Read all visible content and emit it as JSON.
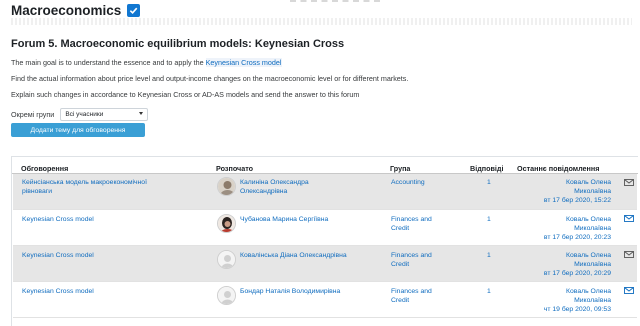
{
  "course": {
    "title": "Macroeconomics"
  },
  "forum": {
    "title": "Forum 5. Macroeconomic equilibrium models: Keynesian Cross",
    "intro_line1_prefix": "The main goal is to understand the essence and to apply the",
    "intro_line1_link": "Keynesian Cross model",
    "intro_line2": "Find the actual information about price level and output-income changes on the macroeconomic level or for different markets.",
    "intro_line3": "Explain such changes in accordance to Keynesian Cross or AD-AS models and send the answer to this forum"
  },
  "groups": {
    "label": "Окремі групи",
    "selected": "Всі учасники"
  },
  "add_button": "Додати тему для обговорення",
  "table": {
    "headers": {
      "discussion": "Обговорення",
      "started": "Розпочато",
      "group": "Група",
      "replies": "Відповіді",
      "last_post": "Останнє повідомлення"
    },
    "rows": [
      {
        "title_1": "Кейнсіанська модель макроекономічної",
        "title_2": "рівноваги",
        "author_1": "Калиніна Олександра",
        "author_2": "Олександрівна",
        "group_1": "Accounting",
        "group_2": "",
        "replies": "1",
        "last_1": "Коваль Олена",
        "last_2": "Миколаївна",
        "last_3": "вт 17 бер 2020, 15:22",
        "mail_color": "#555555"
      },
      {
        "title_1": "Keynesian Cross model",
        "title_2": "",
        "author_1": "Чубанова Марина Сергіївна",
        "author_2": "",
        "group_1": "Finances and",
        "group_2": "Credit",
        "replies": "1",
        "last_1": "Коваль Олена",
        "last_2": "Миколаївна",
        "last_3": "вт 17 бер 2020, 20:23",
        "mail_color": "#0f6cbf"
      },
      {
        "title_1": "Keynesian Cross model",
        "title_2": "",
        "author_1": "Ковалінська Діана Олександрівна",
        "author_2": "",
        "group_1": "Finances and",
        "group_2": "Credit",
        "replies": "1",
        "last_1": "Коваль Олена",
        "last_2": "Миколаївна",
        "last_3": "вт 17 бер 2020, 20:29",
        "mail_color": "#555555"
      },
      {
        "title_1": "Keynesian Cross model",
        "title_2": "",
        "author_1": "Бондар Наталія Володимирівна",
        "author_2": "",
        "group_1": "Finances and",
        "group_2": "Credit",
        "replies": "1",
        "last_1": "Коваль Олена",
        "last_2": "Миколаївна",
        "last_3": "чт 19 бер 2020, 09:53",
        "mail_color": "#0f6cbf"
      }
    ]
  },
  "colors": {
    "link": "#0f6cbf",
    "button": "#3a9fd5",
    "row_shade": "#e6e6e6"
  }
}
